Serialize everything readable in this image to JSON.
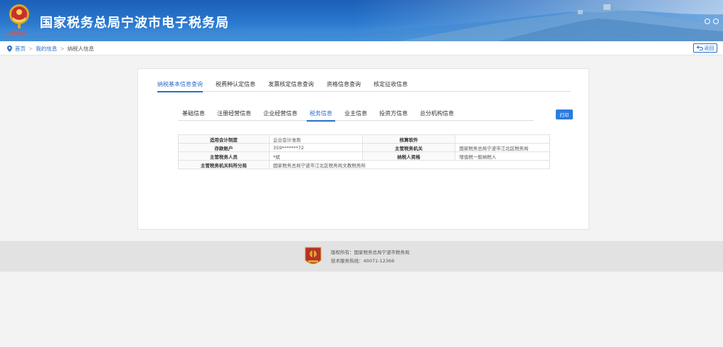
{
  "header": {
    "title": "国家税务总局宁波市电子税务局",
    "emblem_script": "中国税务",
    "emblem_icon": "tax-emblem-icon",
    "tool_icons": [
      "search-icon",
      "search-icon"
    ]
  },
  "breadcrumb": {
    "home": "首页",
    "my_info": "我的信息",
    "current": "纳税人信息",
    "separator": ">"
  },
  "back_button": {
    "label": "返回",
    "icon": "back-arrow-icon"
  },
  "primary_tabs": [
    {
      "label": "纳税基本信息查询",
      "active": true
    },
    {
      "label": "税费种认定信息",
      "active": false
    },
    {
      "label": "发票核定信息查询",
      "active": false
    },
    {
      "label": "资格信息查询",
      "active": false
    },
    {
      "label": "核定征收信息",
      "active": false
    }
  ],
  "secondary_tabs": [
    {
      "label": "基础信息",
      "active": false
    },
    {
      "label": "注册经营信息",
      "active": false
    },
    {
      "label": "企业经营信息",
      "active": false
    },
    {
      "label": "税务信息",
      "active": true
    },
    {
      "label": "业主信息",
      "active": false
    },
    {
      "label": "投资方信息",
      "active": false
    },
    {
      "label": "总分机构信息",
      "active": false
    }
  ],
  "print_button": {
    "label": "打印"
  },
  "info_table": {
    "rows": [
      [
        "适用会计制度",
        "企业会计准则",
        "核算软件",
        ""
      ],
      [
        "存款账户",
        "359*******72",
        "主管税务机关",
        "国家税务总局宁波市江北区税务局"
      ],
      [
        "主管税务人员",
        "*斌",
        "纳税人资格",
        "增值税一般纳税人"
      ],
      [
        "主管税务机关科所分局",
        "国家税务总局宁波市江北区税务局文教税务所",
        "",
        ""
      ]
    ]
  },
  "footer": {
    "copyright": "版权所有：国家税务总局宁波市税务局",
    "hotline": "技术服务热线：40071-12366",
    "logo_icon": "tax-badge-icon"
  },
  "colors": {
    "header_blue": "#1b5fb8",
    "accent": "#2a6fc9",
    "button": "#2a7ce0"
  }
}
